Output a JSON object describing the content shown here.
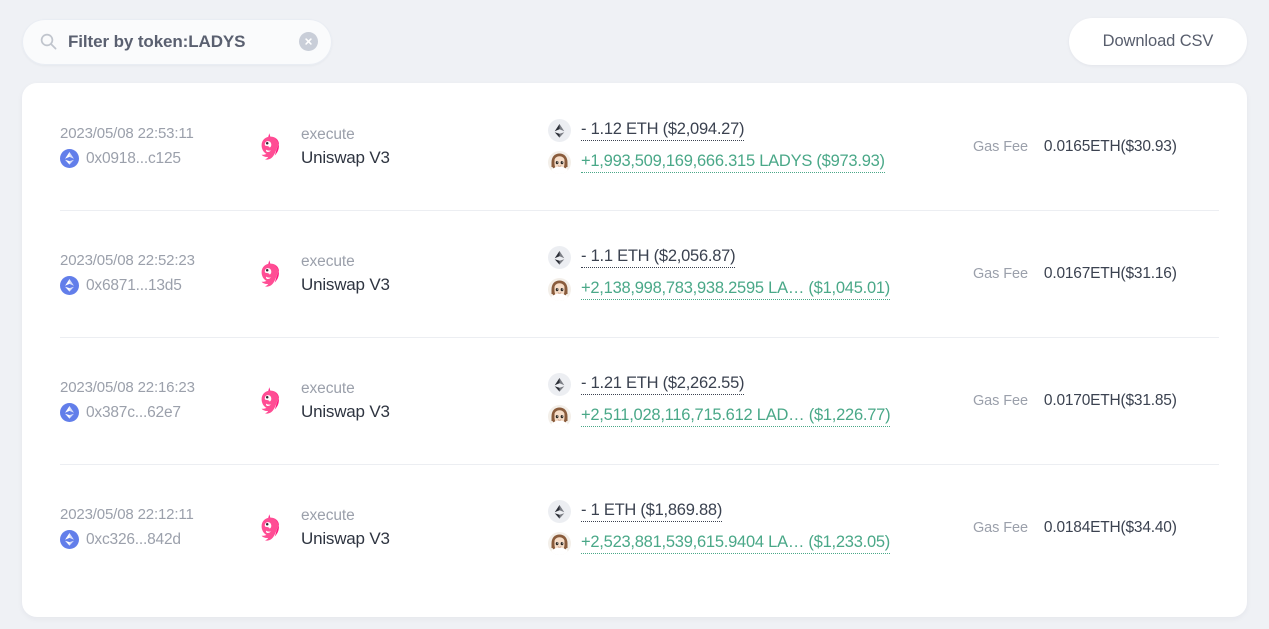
{
  "toolbar": {
    "search": {
      "value": "Filter by token:LADYS",
      "placeholder": "Filter by token",
      "search_icon": "search-icon",
      "clear_icon": "clear-circle-icon"
    },
    "download_label": "Download CSV"
  },
  "colors": {
    "page_background": "#eff1f5",
    "card_background": "#ffffff",
    "muted_text": "#9ba0ab",
    "primary_text": "#2e3440",
    "incoming_green": "#4aa888",
    "outgoing_gray": "#3b4250",
    "eth_badge": "#627eea",
    "uniswap_pink": "#ff007a",
    "divider": "#eceef2"
  },
  "transactions": [
    {
      "time": "2023/05/08 22:53:11",
      "hash": "0x0918...c125",
      "chain_icon": "ethereum-badge-icon",
      "protocol_icon": "uniswap-unicorn-icon",
      "action": "execute",
      "protocol": "Uniswap V3",
      "transfers": [
        {
          "direction": "out",
          "icon": "ethereum-token-icon",
          "text": "- 1.12 ETH ($2,094.27)"
        },
        {
          "direction": "in",
          "icon": "ladys-token-icon",
          "text": "+1,993,509,169,666.315 LADYS ($973.93)"
        }
      ],
      "gas_label": "Gas Fee",
      "gas_value": "0.0165ETH($30.93)"
    },
    {
      "time": "2023/05/08 22:52:23",
      "hash": "0x6871...13d5",
      "chain_icon": "ethereum-badge-icon",
      "protocol_icon": "uniswap-unicorn-icon",
      "action": "execute",
      "protocol": "Uniswap V3",
      "transfers": [
        {
          "direction": "out",
          "icon": "ethereum-token-icon",
          "text": "- 1.1 ETH ($2,056.87)"
        },
        {
          "direction": "in",
          "icon": "ladys-token-icon",
          "text": "+2,138,998,783,938.2595 LA…  ($1,045.01)"
        }
      ],
      "gas_label": "Gas Fee",
      "gas_value": "0.0167ETH($31.16)"
    },
    {
      "time": "2023/05/08 22:16:23",
      "hash": "0x387c...62e7",
      "chain_icon": "ethereum-badge-icon",
      "protocol_icon": "uniswap-unicorn-icon",
      "action": "execute",
      "protocol": "Uniswap V3",
      "transfers": [
        {
          "direction": "out",
          "icon": "ethereum-token-icon",
          "text": "- 1.21 ETH ($2,262.55)"
        },
        {
          "direction": "in",
          "icon": "ladys-token-icon",
          "text": "+2,511,028,116,715.612 LAD…  ($1,226.77)"
        }
      ],
      "gas_label": "Gas Fee",
      "gas_value": "0.0170ETH($31.85)"
    },
    {
      "time": "2023/05/08 22:12:11",
      "hash": "0xc326...842d",
      "chain_icon": "ethereum-badge-icon",
      "protocol_icon": "uniswap-unicorn-icon",
      "action": "execute",
      "protocol": "Uniswap V3",
      "transfers": [
        {
          "direction": "out",
          "icon": "ethereum-token-icon",
          "text": "- 1 ETH ($1,869.88)"
        },
        {
          "direction": "in",
          "icon": "ladys-token-icon",
          "text": "+2,523,881,539,615.9404 LA…  ($1,233.05)"
        }
      ],
      "gas_label": "Gas Fee",
      "gas_value": "0.0184ETH($34.40)"
    }
  ]
}
